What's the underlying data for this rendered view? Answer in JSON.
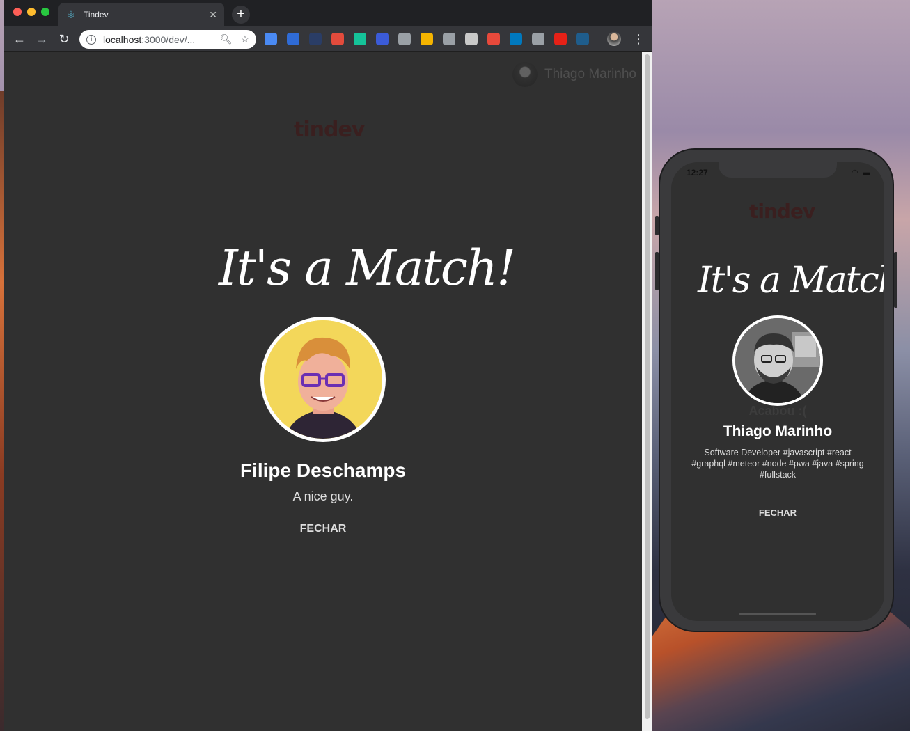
{
  "browser": {
    "tab_title": "Tindev",
    "url_host": "localhost",
    "url_path": ":3000/dev/...",
    "extensions": [
      {
        "name": "translate-ext",
        "color": "#4a8af4"
      },
      {
        "name": "ext-2",
        "color": "#2f6bd6"
      },
      {
        "name": "ext-3",
        "color": "#2a3d66"
      },
      {
        "name": "ext-4",
        "color": "#e34b3c"
      },
      {
        "name": "grammarly-ext",
        "color": "#15c39a"
      },
      {
        "name": "ext-6",
        "color": "#3b5bd8"
      },
      {
        "name": "ext-7",
        "color": "#9aa0a6"
      },
      {
        "name": "ext-8",
        "color": "#f5b400"
      },
      {
        "name": "ext-9",
        "color": "#9aa0a6"
      },
      {
        "name": "ext-10",
        "color": "#c9c9c9"
      },
      {
        "name": "ext-11",
        "color": "#e8493b"
      },
      {
        "name": "trello-ext",
        "color": "#0079bf"
      },
      {
        "name": "ext-13",
        "color": "#9aa0a6"
      },
      {
        "name": "ext-14",
        "color": "#e62117"
      },
      {
        "name": "ext-15",
        "color": "#1f5d8c"
      }
    ]
  },
  "web": {
    "logged_user_name": "Thiago Marinho",
    "logo_text": "tindev",
    "match_title": "It's a Match!",
    "match_name": "Filipe Deschamps",
    "match_bio": "A nice guy.",
    "close_label": "FECHAR"
  },
  "mobile": {
    "status_time": "12:27",
    "logo_text": "tindev",
    "match_title": "It's a Match!",
    "behind_text": "Acabou :(",
    "match_name": "Thiago Marinho",
    "match_bio": "Software Developer #javascript #react #graphql #meteor #node #pwa #java #spring #fullstack",
    "close_label": "FECHAR"
  }
}
